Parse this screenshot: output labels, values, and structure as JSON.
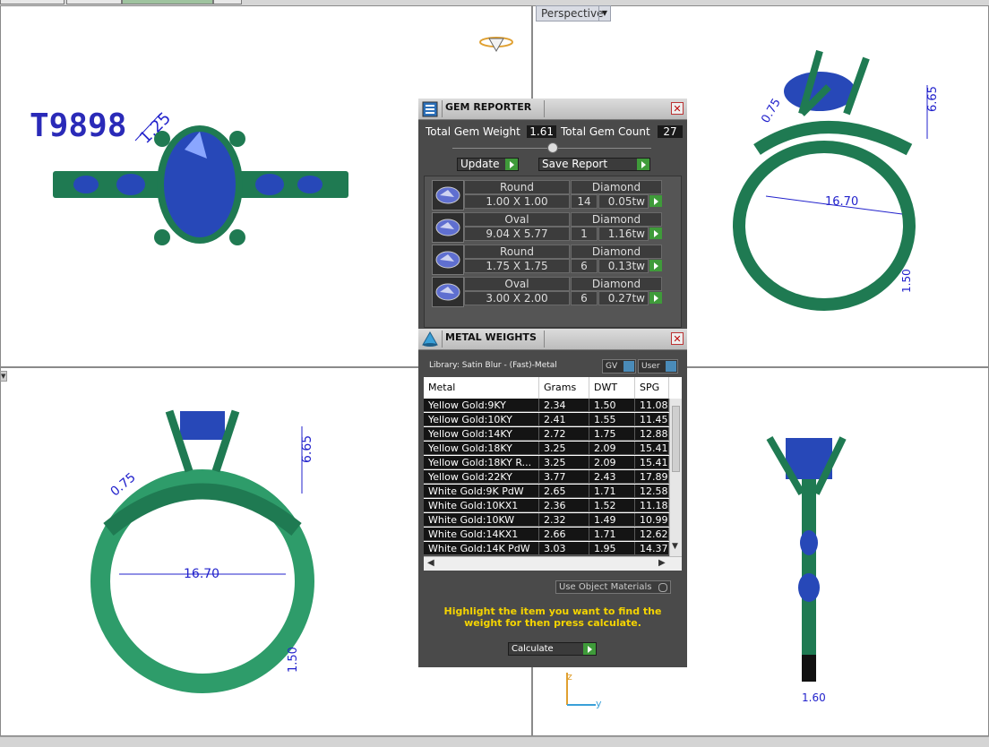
{
  "viewport": {
    "label": "Perspective",
    "model_code": "T9898",
    "dimensions": {
      "top_gem": "1.25",
      "prong_width": "0.75",
      "setting_height": "6.65",
      "inner_diameter": "16.70",
      "shank_thickness": "1.50",
      "shank_width": "1.60"
    },
    "axis_z": "z",
    "axis_y": "y"
  },
  "gem_reporter": {
    "title": "GEM REPORTER",
    "close": "✕",
    "total_weight_label": "Total Gem Weight",
    "total_weight": "1.61",
    "total_count_label": "Total Gem Count",
    "total_count": "27",
    "update_label": "Update",
    "save_label": "Save Report",
    "gems": [
      {
        "shape": "Round",
        "size": "1.00 X 1.00",
        "type": "Diamond",
        "count": "14",
        "weight": "0.05tw"
      },
      {
        "shape": "Oval",
        "size": "9.04 X 5.77",
        "type": "Diamond",
        "count": "1",
        "weight": "1.16tw"
      },
      {
        "shape": "Round",
        "size": "1.75 X 1.75",
        "type": "Diamond",
        "count": "6",
        "weight": "0.13tw"
      },
      {
        "shape": "Oval",
        "size": "3.00 X 2.00",
        "type": "Diamond",
        "count": "6",
        "weight": "0.27tw"
      }
    ]
  },
  "metal_weights": {
    "title": "METAL WEIGHTS",
    "close": "✕",
    "library": "Library: Satin Blur - (Fast)-Metal",
    "gv_label": "GV",
    "user_label": "User",
    "columns": [
      "Metal",
      "Grams",
      "DWT",
      "SPG"
    ],
    "rows": [
      {
        "metal": "Yellow Gold:9KY",
        "grams": "2.34",
        "dwt": "1.50",
        "spg": "11.08"
      },
      {
        "metal": "Yellow Gold:10KY",
        "grams": "2.41",
        "dwt": "1.55",
        "spg": "11.45"
      },
      {
        "metal": "Yellow Gold:14KY",
        "grams": "2.72",
        "dwt": "1.75",
        "spg": "12.88"
      },
      {
        "metal": "Yellow Gold:18KY",
        "grams": "3.25",
        "dwt": "2.09",
        "spg": "15.41"
      },
      {
        "metal": "Yellow Gold:18KY R...",
        "grams": "3.25",
        "dwt": "2.09",
        "spg": "15.41"
      },
      {
        "metal": "Yellow Gold:22KY",
        "grams": "3.77",
        "dwt": "2.43",
        "spg": "17.89"
      },
      {
        "metal": "White Gold:9K PdW",
        "grams": "2.65",
        "dwt": "1.71",
        "spg": "12.58"
      },
      {
        "metal": "White Gold:10KX1",
        "grams": "2.36",
        "dwt": "1.52",
        "spg": "11.18"
      },
      {
        "metal": "White Gold:10KW",
        "grams": "2.32",
        "dwt": "1.49",
        "spg": "10.99"
      },
      {
        "metal": "White Gold:14KX1",
        "grams": "2.66",
        "dwt": "1.71",
        "spg": "12.62"
      },
      {
        "metal": "White Gold:14K PdW",
        "grams": "3.03",
        "dwt": "1.95",
        "spg": "14.37"
      }
    ],
    "use_object_materials": "Use Object Materials",
    "hint": "Highlight the item you want to find the weight for then press calculate.",
    "calculate_label": "Calculate"
  },
  "colors": {
    "metal_green": "#1f7a52",
    "gem_blue": "#2748b8",
    "dimension_blue": "#2222cc",
    "panel_bg": "#4a4a4a",
    "hint_yellow": "#f5d400"
  }
}
